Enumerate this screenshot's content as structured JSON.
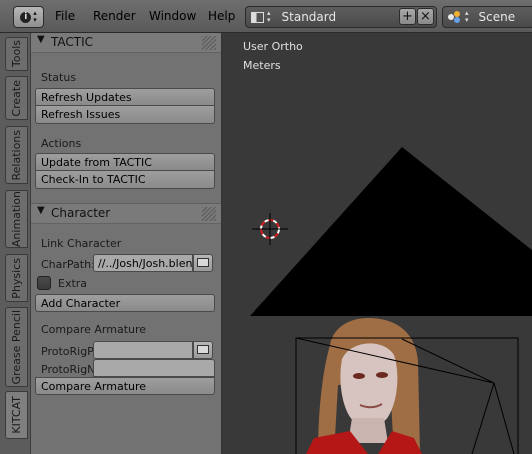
{
  "header": {
    "menus": [
      "File",
      "Render",
      "Window",
      "Help"
    ],
    "screen_layout": "Standard",
    "scene": "Scene"
  },
  "tabs": [
    "Tools",
    "Create",
    "Relations",
    "Animation",
    "Physics",
    "Grease Pencil",
    "KITCAT"
  ],
  "tactic": {
    "title": "TACTIC",
    "status_label": "Status",
    "refresh_updates": "Refresh Updates",
    "refresh_issues": "Refresh Issues",
    "actions_label": "Actions",
    "update_from": "Update from TACTIC",
    "check_in": "Check-In to TACTIC"
  },
  "character": {
    "title": "Character",
    "link_label": "Link Character",
    "charpath_label": "CharPath:",
    "charpath_value": "//../Josh/Josh.blend",
    "extra_label": "Extra",
    "extra_checked": false,
    "add_character": "Add Character",
    "compare_label": "Compare Armature",
    "protorigp_label": "ProtoRigP",
    "protorigp_value": "",
    "protorign_label": "ProtoRigN",
    "protorign_value": "",
    "compare_button": "Compare Armature"
  },
  "viewport": {
    "view_name": "User Ortho",
    "units": "Meters"
  },
  "icons": [
    "info-icon",
    "screen-layout-icon",
    "scene-icon",
    "add-icon",
    "close-icon",
    "folder-icon",
    "3d-cursor-icon"
  ]
}
